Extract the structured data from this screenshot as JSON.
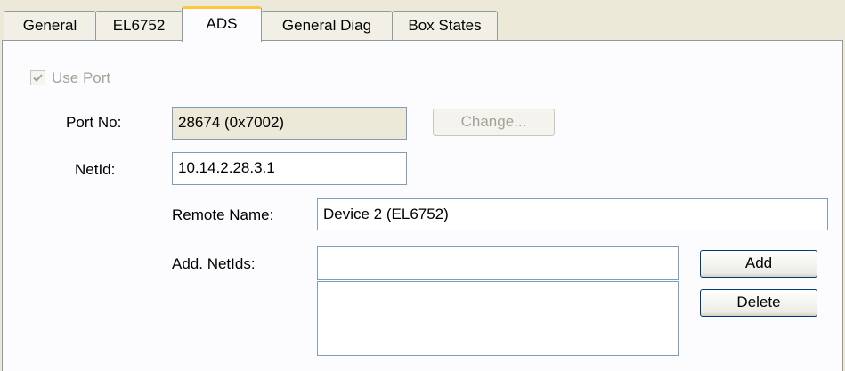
{
  "tabs": [
    {
      "label": "General"
    },
    {
      "label": "EL6752"
    },
    {
      "label": "ADS",
      "active": true
    },
    {
      "label": "General Diag"
    },
    {
      "label": "Box States"
    }
  ],
  "use_port": {
    "label": "Use Port",
    "checked": true,
    "enabled": false
  },
  "port_no": {
    "label": "Port No:",
    "value": "28674 (0x7002)"
  },
  "change_button": {
    "label": "Change...",
    "enabled": false
  },
  "netid": {
    "label": "NetId:",
    "value": "10.14.2.28.3.1"
  },
  "remote_name": {
    "label": "Remote Name:",
    "value": "Device 2 (EL6752)"
  },
  "add_netids": {
    "label": "Add. NetIds:",
    "input_value": "",
    "items": []
  },
  "add_button": {
    "label": "Add"
  },
  "delete_button": {
    "label": "Delete"
  },
  "colors": {
    "active_tab_accent": "#ffc83c",
    "dialog_bg": "#ece9d8",
    "field_border": "#7f9db9"
  }
}
